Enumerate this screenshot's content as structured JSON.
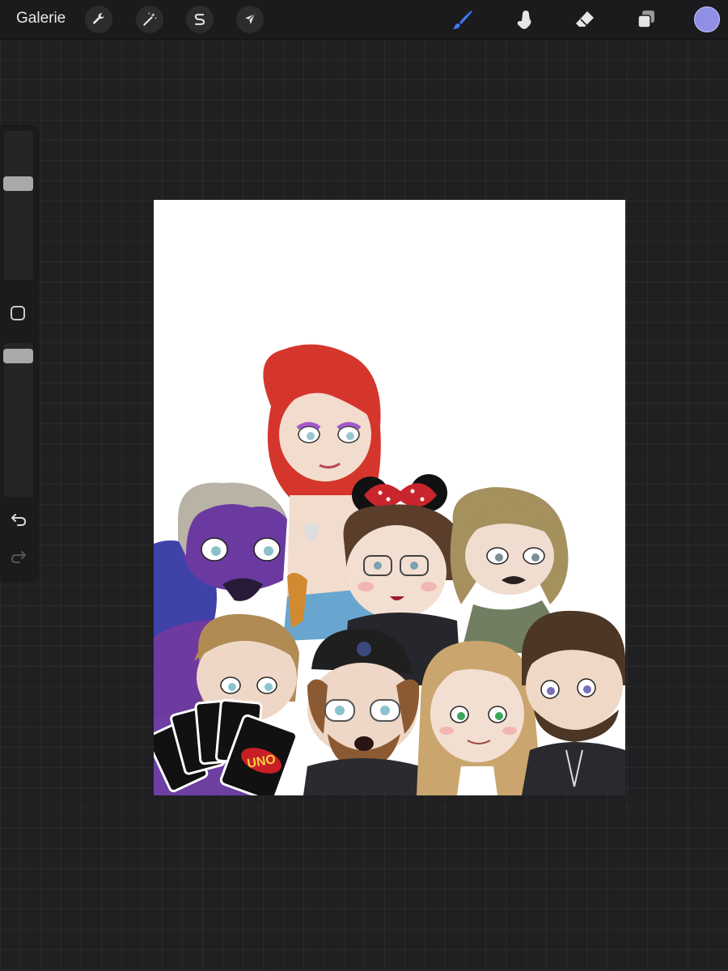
{
  "topbar": {
    "gallery_label": "Galerie",
    "left_tools": [
      {
        "name": "actions",
        "icon": "wrench-icon"
      },
      {
        "name": "adjustments",
        "icon": "magic-wand-icon"
      },
      {
        "name": "selection",
        "icon": "selection-s-icon"
      },
      {
        "name": "transform",
        "icon": "arrow-cursor-icon"
      }
    ],
    "right_tools": [
      {
        "name": "brush",
        "icon": "brush-icon",
        "active": true
      },
      {
        "name": "smudge",
        "icon": "smudge-finger-icon"
      },
      {
        "name": "eraser",
        "icon": "eraser-icon"
      },
      {
        "name": "layers",
        "icon": "layers-icon"
      }
    ],
    "active_color": "#8f8fe6",
    "active_tool_color": "#3a7bff"
  },
  "sidebar": {
    "brush_size_level": 0.66,
    "opacity_level": 0.96,
    "modifier_icon": "square-outline-icon",
    "undo_icon": "undo-arrow-icon",
    "redo_icon": "redo-arrow-icon"
  },
  "canvas": {
    "background": "#ffffff",
    "card_text": "UNO"
  }
}
